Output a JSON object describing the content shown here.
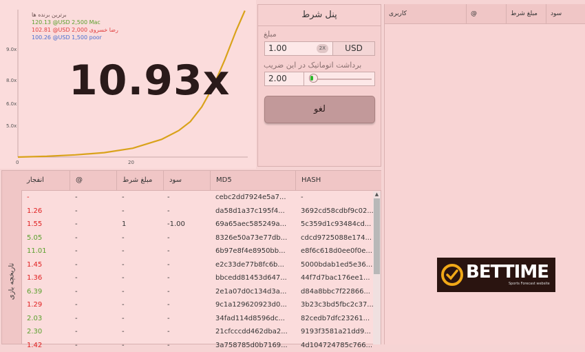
{
  "chart": {
    "top_bets_title": "برترین برنده ها",
    "top_bets": [
      {
        "text": "120.13 @USD 2,500 Mac",
        "color": "#5aa02c"
      },
      {
        "text": "102.81 @USD 2,000 رضا خسروی",
        "color": "#e04040"
      },
      {
        "text": "100.26 @USD 1,500 poor",
        "color": "#4a6fd0"
      }
    ],
    "multiplier": "10.93x",
    "y_ticks": [
      "9.0x",
      "8.0x",
      "6.0x",
      "5.0x"
    ],
    "x_ticks": [
      "0",
      "20"
    ],
    "curve_color": "#d9a21a"
  },
  "chart_data": {
    "type": "line",
    "x": [
      0,
      5,
      10,
      15,
      20,
      25,
      28,
      30,
      32,
      34,
      36,
      38,
      39.5
    ],
    "y": [
      1.0,
      1.05,
      1.15,
      1.3,
      1.6,
      2.2,
      2.8,
      3.4,
      4.4,
      5.8,
      7.6,
      9.6,
      10.93
    ],
    "x_ticks": [
      "0",
      "20"
    ],
    "y_ticks": [
      "5.0x",
      "6.0x",
      "8.0x",
      "9.0x"
    ],
    "current_value": "10.93x"
  },
  "bet_panel": {
    "title": "پنل شرط",
    "amount_label": "مبلغ",
    "amount_value": "1.00",
    "double_label": "2X",
    "currency": "USD",
    "auto_label": "برداشت اتوماتیک در این ضریب",
    "auto_value": "2.00",
    "cancel_label": "لغو"
  },
  "users_panel": {
    "headers": [
      "کاربری",
      "@",
      "مبلغ شرط",
      "سود"
    ]
  },
  "history": {
    "side_label": "تاریخچه بازی",
    "headers": [
      "انفجار",
      "@",
      "مبلغ شرط",
      "سود",
      "MD5",
      "HASH"
    ],
    "rows": [
      {
        "crash": "-",
        "at": "-",
        "bet": "-",
        "profit": "-",
        "md5": "cebc2dd7924e5a7...",
        "hash": "-",
        "color": "#e02020"
      },
      {
        "crash": "1.26",
        "at": "-",
        "bet": "-",
        "profit": "-",
        "md5": "da58d1a37c195f4...",
        "hash": "3692cd58cdbf9c02...",
        "color": "#e02020"
      },
      {
        "crash": "1.55",
        "at": "-",
        "bet": "1",
        "profit": "-1.00",
        "md5": "69a65aec585249a...",
        "hash": "5c359d1c93484cd...",
        "color": "#e02020"
      },
      {
        "crash": "5.05",
        "at": "-",
        "bet": "-",
        "profit": "-",
        "md5": "8326e50a73e77db...",
        "hash": "cdcd9725088e174...",
        "color": "#5aa02c"
      },
      {
        "crash": "11.01",
        "at": "-",
        "bet": "-",
        "profit": "-",
        "md5": "6b97e8f4e8950bb...",
        "hash": "e8f6c618d0ee0f0e...",
        "color": "#5aa02c"
      },
      {
        "crash": "1.45",
        "at": "-",
        "bet": "-",
        "profit": "-",
        "md5": "e2c33de77b8fc6b...",
        "hash": "5000bdab1ed5e36...",
        "color": "#e02020"
      },
      {
        "crash": "1.36",
        "at": "-",
        "bet": "-",
        "profit": "-",
        "md5": "bbcedd81453d647...",
        "hash": "44f7d7bac176ee1...",
        "color": "#e02020"
      },
      {
        "crash": "6.39",
        "at": "-",
        "bet": "-",
        "profit": "-",
        "md5": "2e1a07d0c134d3a...",
        "hash": "d84a8bbc7f22866...",
        "color": "#5aa02c"
      },
      {
        "crash": "1.29",
        "at": "-",
        "bet": "-",
        "profit": "-",
        "md5": "9c1a129620923d0...",
        "hash": "3b23c3bd5fbc2c37...",
        "color": "#e02020"
      },
      {
        "crash": "2.03",
        "at": "-",
        "bet": "-",
        "profit": "-",
        "md5": "34fad114d8596dc...",
        "hash": "82cedb7dfc23261...",
        "color": "#5aa02c"
      },
      {
        "crash": "2.30",
        "at": "-",
        "bet": "-",
        "profit": "-",
        "md5": "21cfcccdd462dba2...",
        "hash": "9193f3581a21dd9...",
        "color": "#5aa02c"
      },
      {
        "crash": "1.42",
        "at": "-",
        "bet": "-",
        "profit": "-",
        "md5": "3a758785d0b7169...",
        "hash": "4d104724785c766...",
        "color": "#e02020"
      }
    ]
  },
  "logo": {
    "name": "BETTIME",
    "tagline": "Sports Forecast website"
  }
}
